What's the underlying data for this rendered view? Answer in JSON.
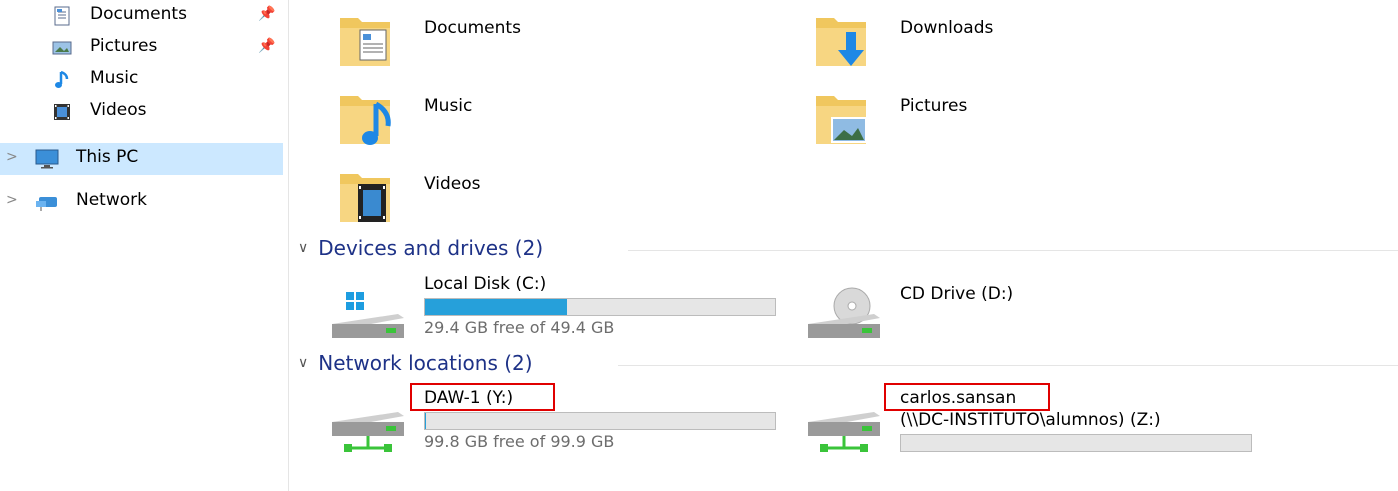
{
  "sidebar": {
    "items": [
      {
        "label": "Documents",
        "icon": "documents-icon",
        "pinned": true
      },
      {
        "label": "Pictures",
        "icon": "pictures-icon",
        "pinned": true
      },
      {
        "label": "Music",
        "icon": "music-icon",
        "pinned": false
      },
      {
        "label": "Videos",
        "icon": "videos-icon",
        "pinned": false
      },
      {
        "label": "This PC",
        "icon": "this-pc-icon",
        "selected": true
      },
      {
        "label": "Network",
        "icon": "network-icon"
      }
    ]
  },
  "folders": [
    {
      "label": "Documents",
      "icon": "documents-folder-icon"
    },
    {
      "label": "Downloads",
      "icon": "downloads-folder-icon"
    },
    {
      "label": "Music",
      "icon": "music-folder-icon"
    },
    {
      "label": "Pictures",
      "icon": "pictures-folder-icon"
    },
    {
      "label": "Videos",
      "icon": "videos-folder-icon"
    }
  ],
  "devices_section": {
    "title": "Devices and drives (2)"
  },
  "drives": [
    {
      "name": "Local Disk (C:)",
      "free": "29.4 GB free of 49.4 GB",
      "used_fraction": 0.405,
      "icon": "local-disk-icon"
    },
    {
      "name": "CD Drive (D:)",
      "icon": "cd-drive-icon"
    }
  ],
  "network_section": {
    "title": "Network locations (2)"
  },
  "network_drives": [
    {
      "name": "DAW-1 (Y:)",
      "free": "99.8 GB free of 99.9 GB",
      "used_fraction": 0.001,
      "icon": "network-drive-icon"
    },
    {
      "name_line1": "carlos.sansan",
      "name_line2": "(\\\\DC-INSTITUTO\\alumnos) (Z:)",
      "used_fraction": 0.0,
      "icon": "network-drive-icon"
    }
  ],
  "colors": {
    "selection": "#cce8ff",
    "accent": "#26a0da",
    "section_title": "#1e3287",
    "highlight_box": "#e00000"
  }
}
